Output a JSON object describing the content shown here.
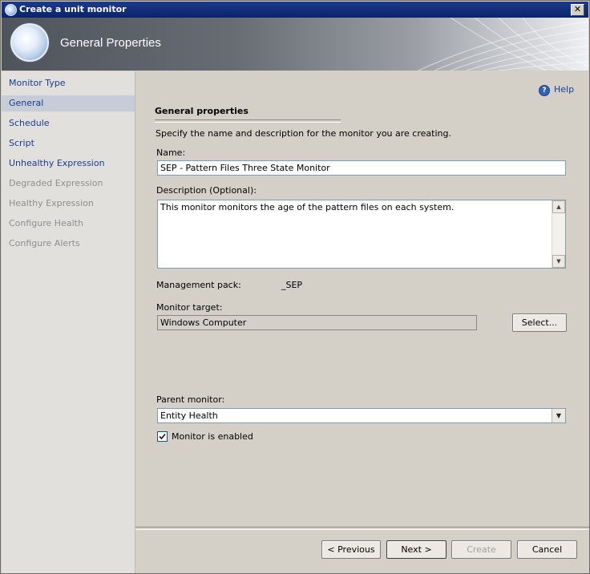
{
  "window": {
    "title": "Create a unit monitor",
    "close_glyph": "✕"
  },
  "banner": {
    "title": "General Properties"
  },
  "sidebar": {
    "items": [
      {
        "label": "Monitor Type",
        "state": "link"
      },
      {
        "label": "General",
        "state": "selected"
      },
      {
        "label": "Schedule",
        "state": "link"
      },
      {
        "label": "Script",
        "state": "link"
      },
      {
        "label": "Unhealthy Expression",
        "state": "link"
      },
      {
        "label": "Degraded Expression",
        "state": "disabled"
      },
      {
        "label": "Healthy Expression",
        "state": "disabled"
      },
      {
        "label": "Configure Health",
        "state": "disabled"
      },
      {
        "label": "Configure Alerts",
        "state": "disabled"
      }
    ]
  },
  "help": {
    "label": "Help",
    "icon": "help-icon"
  },
  "section": {
    "heading": "General properties",
    "instruction": "Specify the name and description for the monitor you are creating."
  },
  "name": {
    "label": "Name:",
    "value": "SEP - Pattern Files Three State Monitor"
  },
  "description": {
    "label": "Description (Optional):",
    "value": "This monitor monitors the age of the pattern files on each system."
  },
  "management_pack": {
    "label": "Management pack:",
    "value": "_SEP"
  },
  "monitor_target": {
    "label": "Monitor target:",
    "value": "Windows Computer",
    "select_label": "Select..."
  },
  "parent_monitor": {
    "label": "Parent monitor:",
    "value": "Entity Health"
  },
  "enabled": {
    "label": "Monitor is enabled",
    "checked": true
  },
  "footer": {
    "previous": "< Previous",
    "next": "Next >",
    "create": "Create",
    "cancel": "Cancel"
  },
  "colors": {
    "titlebar": "#0a246a",
    "link": "#1a3c8f",
    "selected_nav": "#c6cdd8",
    "disabled": "#8e8e8e"
  }
}
